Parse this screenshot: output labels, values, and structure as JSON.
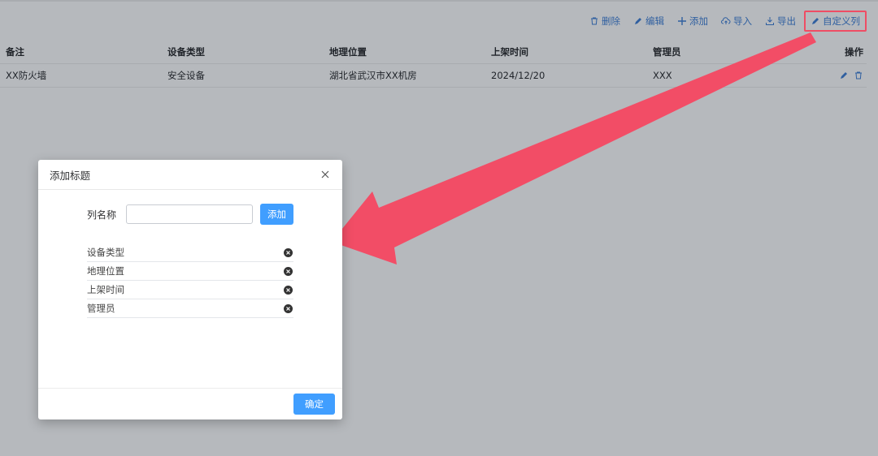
{
  "toolbar": {
    "delete_label": "删除",
    "edit_label": "编辑",
    "add_label": "添加",
    "import_label": "导入",
    "export_label": "导出",
    "custom_columns_label": "自定义列"
  },
  "table": {
    "columns": [
      "备注",
      "设备类型",
      "地理位置",
      "上架时间",
      "管理员",
      "操作"
    ],
    "rows": [
      [
        "XX防火墙",
        "安全设备",
        "湖北省武汉市XX机房",
        "2024/12/20",
        "XXX"
      ]
    ]
  },
  "modal": {
    "title": "添加标题",
    "field_label": "列名称",
    "input_value": "",
    "add_button": "添加",
    "items": [
      "设备类型",
      "地理位置",
      "上架时间",
      "管理员"
    ],
    "confirm_button": "确定"
  },
  "colors": {
    "accent": "#409eff",
    "link": "#2f5fa0",
    "highlight": "#ef4d64",
    "overlay_bg": "#b6b9bd"
  },
  "icons": {
    "delete": "trash-icon",
    "edit": "pencil-icon",
    "add": "plus-icon",
    "import": "cloud-upload-icon",
    "export": "download-icon",
    "custom": "pencil-icon",
    "close": "close-icon",
    "remove": "x-circle-icon"
  }
}
